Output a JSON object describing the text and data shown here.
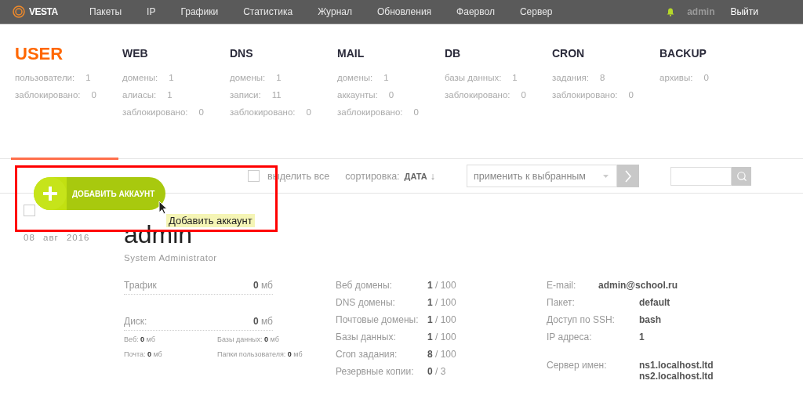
{
  "topbar": {
    "logo": "VESTA",
    "menu": [
      {
        "label": "Пакеты",
        "selected": false
      },
      {
        "label": "IP",
        "selected": false
      },
      {
        "label": "Графики",
        "selected": false
      },
      {
        "label": "Статистика",
        "selected": false
      },
      {
        "label": "Журнал",
        "selected": false
      },
      {
        "label": "Обновления",
        "selected": false
      },
      {
        "label": "Фаервол",
        "selected": false
      },
      {
        "label": "Сервер",
        "selected": false
      }
    ],
    "user": "admin",
    "logout": "Выйти"
  },
  "stats": [
    {
      "title": "USER",
      "selected": true,
      "rows": [
        {
          "label": "пользователи:",
          "value": "1"
        },
        {
          "label": "заблокировано:",
          "value": "0"
        }
      ]
    },
    {
      "title": "WEB",
      "selected": false,
      "rows": [
        {
          "label": "домены:",
          "value": "1"
        },
        {
          "label": "алиасы:",
          "value": "1"
        },
        {
          "label": "заблокировано:",
          "value": "0"
        }
      ]
    },
    {
      "title": "DNS",
      "selected": false,
      "rows": [
        {
          "label": "домены:",
          "value": "1"
        },
        {
          "label": "записи:",
          "value": "11"
        },
        {
          "label": "заблокировано:",
          "value": "0"
        }
      ]
    },
    {
      "title": "MAIL",
      "selected": false,
      "rows": [
        {
          "label": "домены:",
          "value": "1"
        },
        {
          "label": "аккаунты:",
          "value": "0"
        },
        {
          "label": "заблокировано:",
          "value": "0"
        }
      ]
    },
    {
      "title": "DB",
      "selected": false,
      "rows": [
        {
          "label": "базы данных:",
          "value": "1"
        },
        {
          "label": "заблокировано:",
          "value": "0"
        }
      ]
    },
    {
      "title": "CRON",
      "selected": false,
      "rows": [
        {
          "label": "задания:",
          "value": "8"
        },
        {
          "label": "заблокировано:",
          "value": "0"
        }
      ]
    },
    {
      "title": "BACKUP",
      "selected": false,
      "rows": [
        {
          "label": "архивы:",
          "value": "0"
        }
      ]
    }
  ],
  "toolbar": {
    "select_all": {
      "label": "выделить все",
      "checked": false
    },
    "sort_label": "сортировка:",
    "sort_value": "ДАТА",
    "sort_arrow": "↓",
    "bulk_action": {
      "placeholder": "применить к выбранным"
    }
  },
  "add_button": {
    "label": "ДОБАВИТЬ АККАУНТ",
    "tooltip": "Добавить аккаунт",
    "highlighted": true
  },
  "user": {
    "checked": false,
    "date": "08 авг 2016",
    "name": "admin",
    "role": "System Administrator",
    "usage": [
      {
        "label": "Трафик",
        "value": "**0** мб"
      },
      {
        "label": "Диск:",
        "value": "**0** мб"
      }
    ],
    "disk_parts": [
      "Веб: **0** мб",
      "Базы данных: **0** мб",
      "Почта: **0** мб",
      "Папки пользователя: **0** мб"
    ],
    "limits": [
      {
        "label": "Веб домены:",
        "value": "**1** / 100"
      },
      {
        "label": "DNS домены:",
        "value": "**1** / 100"
      },
      {
        "label": "Почтовые домены:",
        "value": "**1** / 100"
      },
      {
        "label": "Базы данных:",
        "value": "**1** / 100"
      },
      {
        "label": "Cron задания:",
        "value": "**8** / 100"
      },
      {
        "label": "Резервные копии:",
        "value": "**0** / 3"
      }
    ],
    "info": [
      {
        "label": "E-mail:",
        "values": [
          "admin@school.ru"
        ],
        "kind": "email"
      },
      {
        "label": "Пакет:",
        "values": [
          "default"
        ],
        "kind": "field"
      },
      {
        "label": "Доступ по SSH:",
        "values": [
          "bash"
        ],
        "kind": "field"
      },
      {
        "label": "IP адреса:",
        "values": [
          "1"
        ],
        "kind": "field"
      },
      {
        "label": "Сервер имен:",
        "values": [
          "ns1.localhost.ltd",
          "ns2.localhost.ltd"
        ],
        "kind": "spaced"
      }
    ]
  }
}
